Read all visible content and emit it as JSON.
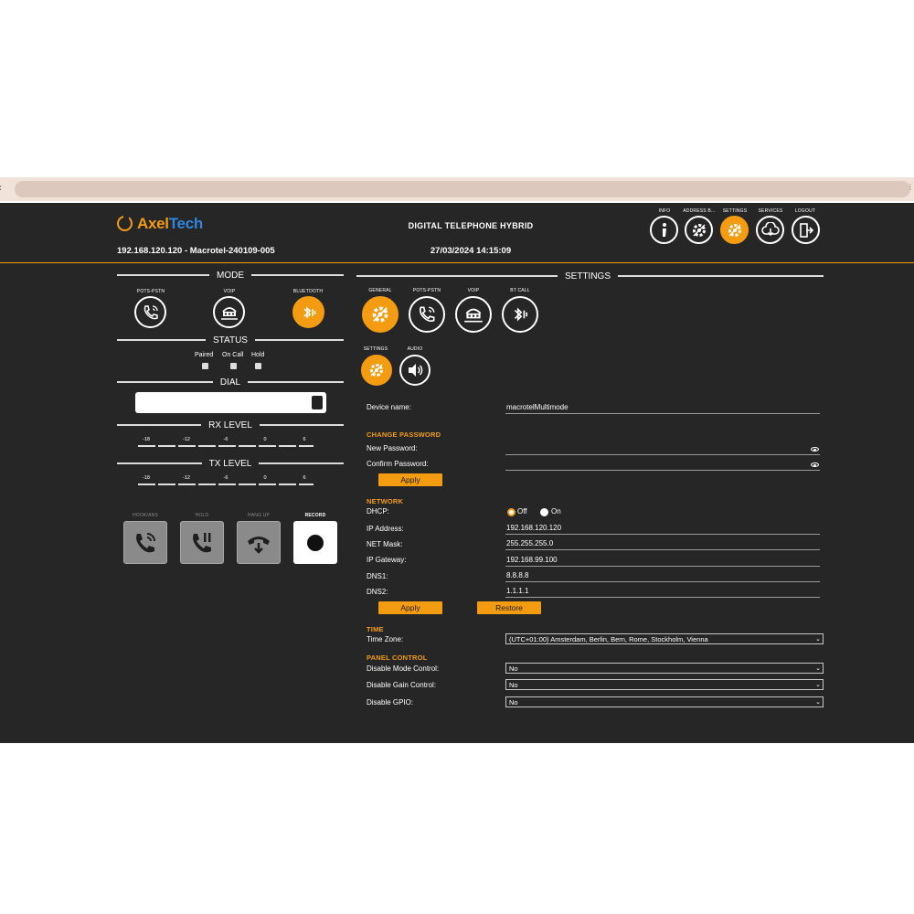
{
  "header": {
    "logo_part1": "Axel",
    "logo_part2": "Tech",
    "title": "DIGITAL TELEPHONE HYBRID",
    "device_id": "192.168.120.120 - Macrotel-240109-005",
    "datetime": "27/03/2024 14:15:09",
    "nav": [
      {
        "label": "INFO",
        "icon": "info-icon",
        "active": false
      },
      {
        "label": "ADDRESS B...",
        "icon": "address-book-icon",
        "active": false
      },
      {
        "label": "SETTINGS",
        "icon": "settings-icon",
        "active": true
      },
      {
        "label": "SERVICES",
        "icon": "cloud-download-icon",
        "active": false
      },
      {
        "label": "LOGOUT",
        "icon": "logout-icon",
        "active": false
      }
    ]
  },
  "left": {
    "mode_heading": "MODE",
    "modes": [
      {
        "label": "POTS-PSTN",
        "icon": "phone-icon",
        "active": false
      },
      {
        "label": "VOIP",
        "icon": "network-icon",
        "active": false
      },
      {
        "label": "BLUETOOTH",
        "icon": "bluetooth-icon",
        "active": true
      }
    ],
    "status_heading": "STATUS",
    "status_items": [
      "Paired",
      "On Call",
      "Hold"
    ],
    "dial_heading": "DIAL",
    "dial_value": "",
    "rx_heading": "RX LEVEL",
    "tx_heading": "TX LEVEL",
    "meter_ticks": [
      "-18",
      "-12",
      "-6",
      "0",
      "6"
    ],
    "controls": [
      {
        "label": "HOOK/ANS",
        "icon": "answer-call-icon"
      },
      {
        "label": "HOLD",
        "icon": "hold-call-icon"
      },
      {
        "label": "HANG UP",
        "icon": "hang-up-icon"
      },
      {
        "label": "RECORD",
        "icon": "record-icon"
      }
    ]
  },
  "settings": {
    "heading": "SETTINGS",
    "tabs": [
      {
        "label": "GENERAL",
        "icon": "settings-icon",
        "active": true
      },
      {
        "label": "POTS-PSTN",
        "icon": "phone-icon",
        "active": false
      },
      {
        "label": "VOIP",
        "icon": "network-icon",
        "active": false
      },
      {
        "label": "BT CALL",
        "icon": "bluetooth-icon",
        "active": false
      }
    ],
    "subtabs": [
      {
        "label": "SETTINGS",
        "icon": "settings-icon",
        "active": true
      },
      {
        "label": "AUDIO",
        "icon": "speaker-icon",
        "active": false
      }
    ],
    "device_name_label": "Device name:",
    "device_name_value": "macrotelMultimode",
    "change_password_heading": "CHANGE PASSWORD",
    "new_password_label": "New Password:",
    "new_password_value": "",
    "confirm_password_label": "Confirm Password:",
    "confirm_password_value": "",
    "apply_label": "Apply",
    "network_heading": "NETWORK",
    "dhcp_label": "DHCP:",
    "dhcp_off": "Off",
    "dhcp_on": "On",
    "dhcp_selected": "Off",
    "ip_label": "IP Address:",
    "ip_value": "192.168.120.120",
    "mask_label": "NET Mask:",
    "mask_value": "255.255.255.0",
    "gateway_label": "IP Gateway:",
    "gateway_value": "192.168.99.100",
    "dns1_label": "DNS1:",
    "dns1_value": "8.8.8.8",
    "dns2_label": "DNS2:",
    "dns2_value": "1.1.1.1",
    "network_apply_label": "Apply",
    "network_restore_label": "Restore",
    "time_heading": "TIME",
    "timezone_label": "Time Zone:",
    "timezone_value": "(UTC+01:00) Amsterdam, Berlin, Bern, Rome, Stockholm, Vienna",
    "panel_heading": "PANEL CONTROL",
    "mode_control_label": "Disable Mode Control:",
    "mode_control_value": "No",
    "gain_control_label": "Disable Gain Control:",
    "gain_control_value": "No",
    "gpio_label": "Disable GPIO:",
    "gpio_value": "No"
  },
  "colors": {
    "accent": "#f39c12",
    "background": "#262626",
    "brand_blue": "#2e86de"
  }
}
